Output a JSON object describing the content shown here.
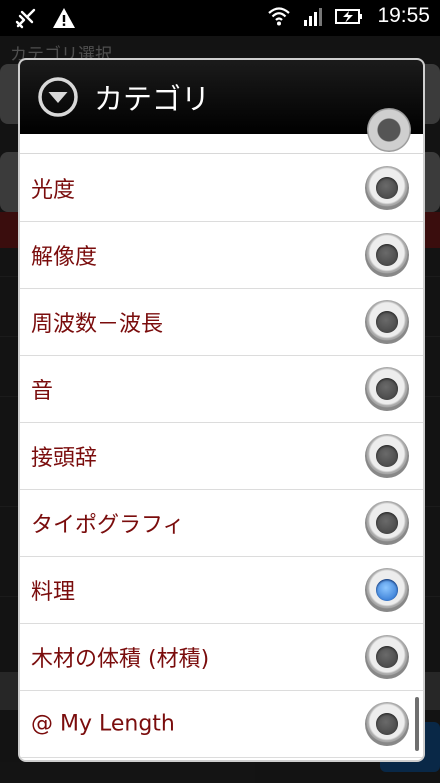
{
  "status_bar": {
    "time": "19:55",
    "left_icons": [
      "usb-debug-icon",
      "warning-icon"
    ],
    "right_icons": [
      "wifi-icon",
      "signal-icon",
      "battery-charging-icon"
    ]
  },
  "background": {
    "title": "カテゴリ選択"
  },
  "dialog": {
    "title": "カテゴリ",
    "header_icon": "dropdown-circle-icon",
    "items": [
      {
        "label": "光度",
        "selected": false
      },
      {
        "label": "解像度",
        "selected": false
      },
      {
        "label": "周波数－波長",
        "selected": false
      },
      {
        "label": "音",
        "selected": false
      },
      {
        "label": "接頭辞",
        "selected": false
      },
      {
        "label": "タイポグラフィ",
        "selected": false
      },
      {
        "label": "料理",
        "selected": true
      },
      {
        "label": "木材の体積 (材積)",
        "selected": false
      },
      {
        "label": "@ My Length",
        "selected": false
      }
    ]
  },
  "colors": {
    "label": "#7a0c0c",
    "selected_radio": "#2168c9",
    "header_bg": "#000000"
  }
}
